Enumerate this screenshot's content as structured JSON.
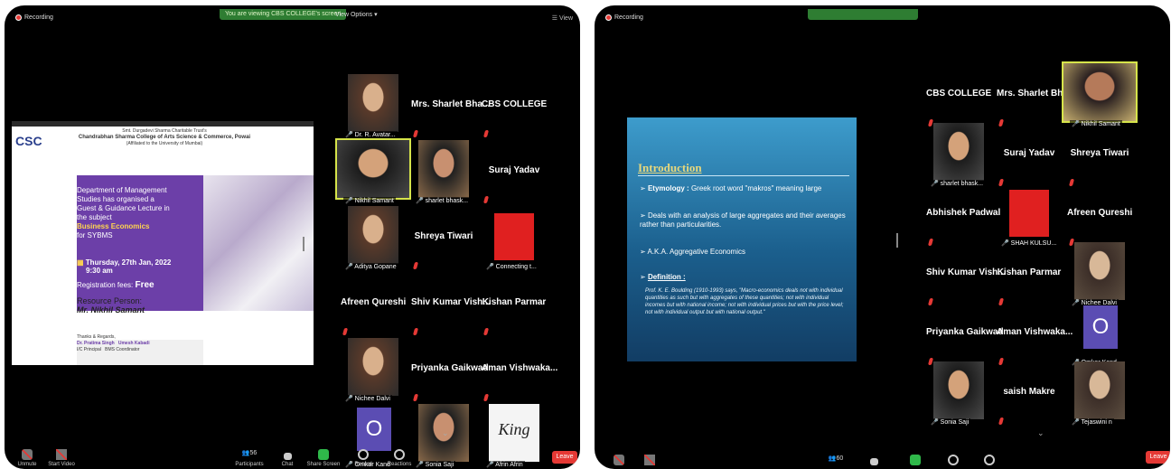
{
  "window1": {
    "recording_label": "Recording",
    "banner_text": "You are viewing CBS COLLEGE's screen",
    "view_options_label": "View Options",
    "view_label": "View",
    "poster": {
      "org_line1": "Smt. Durgadevi Sharma Charitable Trust's",
      "org_line2": "Chandrabhan Sharma College of Arts Science & Commerce, Powai",
      "org_line3": "(Affiliated to the University of Mumbai)",
      "logo_text": "CSC",
      "body_lines": [
        "Department of Management",
        "Studies has organised a",
        "Guest & Guidance Lecture in",
        "the subject"
      ],
      "subject": "Business Economics",
      "for_text": "for SYBMS",
      "date_text": "Thursday, 27th Jan, 2022",
      "time_text": "9:30 am",
      "fees_label": "Registration fees:",
      "fees_value": "Free",
      "resource_label": "Resource Person:",
      "resource_name": "Mr. Nikhil Samant",
      "thanks": "Thanks & Regards,",
      "signatory1": "Dr. Pratima Singh",
      "signatory1_role": "I/C Principal",
      "signatory2": "Umesh Kabadi",
      "signatory2_role": "BMS Coordinator"
    },
    "participants": [
      {
        "name": "Dr. R. Avatar...",
        "type": "photo"
      },
      {
        "name": "Mrs. Sharlet Bha...",
        "type": "name"
      },
      {
        "name": "CBS COLLEGE",
        "type": "name"
      },
      {
        "name": "Nikhil Samant",
        "type": "photo"
      },
      {
        "name": "sharlet bhask...",
        "type": "photo"
      },
      {
        "name": "Suraj Yadav",
        "type": "name"
      },
      {
        "name": "Aditya Gopane",
        "type": "photo"
      },
      {
        "name": "Shreya Tiwari",
        "type": "name"
      },
      {
        "name": "Connecting t...",
        "type": "red"
      },
      {
        "name": "Afreen Qureshi",
        "type": "name"
      },
      {
        "name": "Shiv Kumar Vish...",
        "type": "name"
      },
      {
        "name": "Kishan Parmar",
        "type": "name"
      },
      {
        "name": "Nichee Dalvi",
        "type": "photo"
      },
      {
        "name": "Priyanka Gaikwad",
        "type": "name"
      },
      {
        "name": "Aman Vishwaka...",
        "type": "name"
      },
      {
        "name": "Omkar Kand",
        "type": "avatar",
        "initial": "O"
      },
      {
        "name": "Sonia Saji",
        "type": "photo"
      },
      {
        "name": "Afrin Afrin",
        "type": "photo",
        "logo_text": "King"
      }
    ],
    "toolbar": {
      "unmute": "Unmute",
      "start_video": "Start Video",
      "participants": "Participants",
      "participants_count": "56",
      "chat": "Chat",
      "share_screen": "Share Screen",
      "record": "Record",
      "reactions": "Reactions",
      "leave": "Leave"
    }
  },
  "window2": {
    "recording_label": "Recording",
    "slide": {
      "title": "Introduction",
      "bullet1_label": "Etymology :",
      "bullet1_text": "Greek root word \"makros\" meaning large",
      "bullet2": "Deals with an analysis of large aggregates and their averages rather than particularities.",
      "bullet3": "A.K.A. Aggregative Economics",
      "bullet4_label": "Definition :",
      "definition": "Prof. K. E. Boulding (1910-1993) says, \"Macro-economics deals not with individual quantities as such but with aggregates of these quantities; not with individual incomes but with national income; not with individual prices but with the price level; not with individual output but with national output.\""
    },
    "participants": [
      {
        "name": "CBS COLLEGE",
        "type": "name"
      },
      {
        "name": "Mrs. Sharlet Bha...",
        "type": "name"
      },
      {
        "name": "Nikhil Samant",
        "type": "photo"
      },
      {
        "name": "sharlet bhask...",
        "type": "photo"
      },
      {
        "name": "Suraj Yadav",
        "type": "name"
      },
      {
        "name": "Shreya Tiwari",
        "type": "name"
      },
      {
        "name": "Abhishek Padwal",
        "type": "name"
      },
      {
        "name": "SHAH KULSU...",
        "type": "red"
      },
      {
        "name": "Afreen Qureshi",
        "type": "name"
      },
      {
        "name": "Shiv Kumar Vish...",
        "type": "name"
      },
      {
        "name": "Kishan Parmar",
        "type": "name"
      },
      {
        "name": "Nichee Dalvi",
        "type": "photo"
      },
      {
        "name": "Priyanka Gaikwad",
        "type": "name"
      },
      {
        "name": "Aman Vishwaka...",
        "type": "name"
      },
      {
        "name": "Omkar Kand",
        "type": "avatar",
        "initial": "O"
      },
      {
        "name": "Sonia Saji",
        "type": "photo"
      },
      {
        "name": "saish Makre",
        "type": "name"
      },
      {
        "name": "Tejaswini n",
        "type": "photo"
      }
    ],
    "toolbar": {
      "participants_count": "60",
      "leave": "Leave"
    }
  },
  "colors": {
    "window_bg": "#000000",
    "highlight_border": "#d6e44a",
    "leave_red": "#e53935",
    "share_green": "#2e7d32",
    "avatar_purple": "#5b4db3"
  }
}
